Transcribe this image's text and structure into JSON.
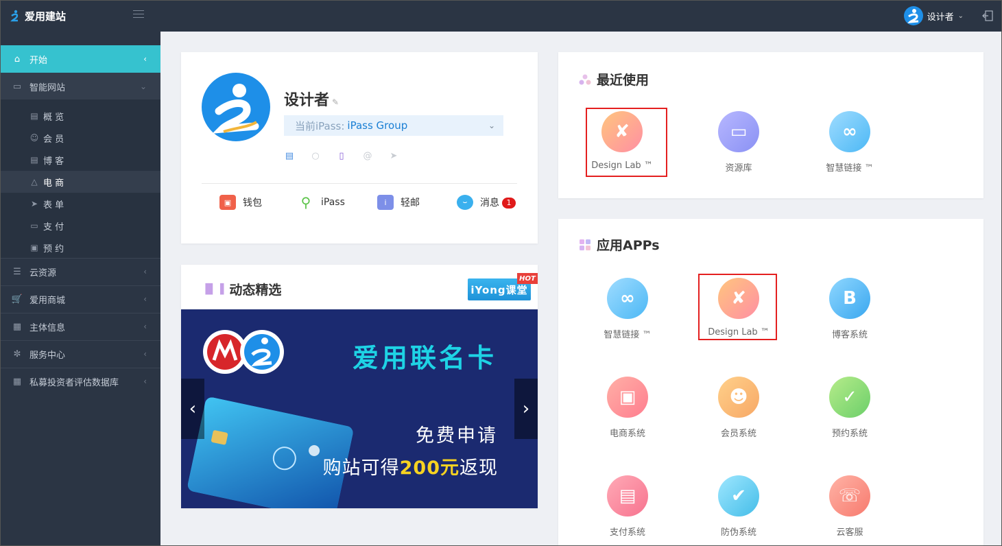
{
  "brand": {
    "name": "爱用建站"
  },
  "user": {
    "name": "设计者",
    "chevron": "chevron-down-icon"
  },
  "sidebar": {
    "items": [
      {
        "label": "开始",
        "icon": "home-icon"
      },
      {
        "label": "智能网站",
        "icon": "monitor-icon"
      },
      {
        "label": "云资源",
        "icon": "list-icon"
      },
      {
        "label": "爱用商城",
        "icon": "cart-icon"
      },
      {
        "label": "主体信息",
        "icon": "building-icon"
      },
      {
        "label": "服务中心",
        "icon": "loading-icon"
      },
      {
        "label": "私募投资者评估数据库",
        "icon": "calendar-icon"
      }
    ],
    "sub": [
      {
        "label": "概 览",
        "icon": "chart-icon"
      },
      {
        "label": "会 员",
        "icon": "user-icon"
      },
      {
        "label": "博 客",
        "icon": "document-icon"
      },
      {
        "label": "电 商",
        "icon": "bag-icon"
      },
      {
        "label": "表 单",
        "icon": "send-icon"
      },
      {
        "label": "支 付",
        "icon": "folder-icon"
      },
      {
        "label": "预 约",
        "icon": "calendar-check-icon"
      }
    ]
  },
  "profile": {
    "name": "设计者",
    "ipass_prefix": "当前iPass:",
    "ipass_value": "iPass Group",
    "quick": [
      {
        "label": "钱包",
        "icon": "wallet-icon",
        "color": "#f0614a"
      },
      {
        "label": "iPass",
        "icon": "key-icon",
        "color": "#5cc44a"
      },
      {
        "label": "轻邮",
        "icon": "mail-icon",
        "color": "#7d8fe8"
      },
      {
        "label": "消息",
        "icon": "message-icon",
        "color": "#3ab0ee"
      }
    ],
    "message_count": "1"
  },
  "news": {
    "title": "动态精选",
    "badge_button": "iYong课堂",
    "hot": "HOT",
    "banner_title": "爱用联名卡",
    "banner_line1": "免费申请",
    "banner_line2_pre": "购站可得",
    "banner_line2_hl": "200元",
    "banner_line2_post": "返现"
  },
  "recent": {
    "title": "最近使用",
    "apps": [
      {
        "label": "Design Lab ™",
        "icon": "design-lab-icon"
      },
      {
        "label": "资源库",
        "icon": "folder-icon"
      },
      {
        "label": "智慧链接 ™",
        "icon": "link-icon"
      }
    ]
  },
  "apps": {
    "title": "应用APPs",
    "items": [
      {
        "label": "智慧链接 ™",
        "icon": "link-icon"
      },
      {
        "label": "Design Lab ™",
        "icon": "design-lab-icon"
      },
      {
        "label": "博客系统",
        "icon": "blog-icon",
        "glyph": "B"
      },
      {
        "label": "电商系统",
        "icon": "shop-icon"
      },
      {
        "label": "会员系统",
        "icon": "user-icon"
      },
      {
        "label": "预约系统",
        "icon": "calendar-check-icon"
      },
      {
        "label": "支付系统",
        "icon": "card-icon"
      },
      {
        "label": "防伪系统",
        "icon": "shield-icon"
      },
      {
        "label": "云客服",
        "icon": "headset-icon"
      }
    ]
  }
}
